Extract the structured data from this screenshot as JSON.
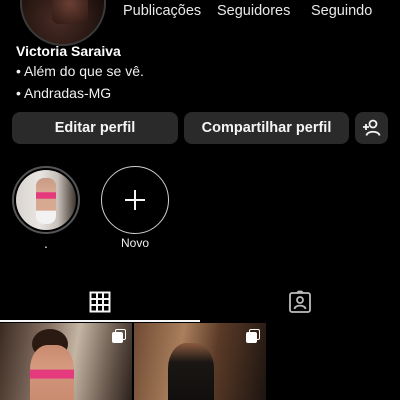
{
  "profile": {
    "stats": {
      "posts_label": "Publicações",
      "followers_label": "Seguidores",
      "following_label": "Seguindo"
    },
    "name": "Victoria Saraiva",
    "bio_lines": [
      "• Além do que se vê.",
      "• Andradas-MG"
    ]
  },
  "actions": {
    "edit_label": "Editar perfil",
    "share_label": "Compartilhar perfil",
    "add_person_icon": "add-person-icon"
  },
  "highlights": [
    {
      "label": "."
    },
    {
      "label": "Novo",
      "icon": "plus-icon"
    }
  ],
  "tabs": [
    {
      "name": "posts-grid",
      "icon": "grid-icon",
      "selected": true
    },
    {
      "name": "tagged",
      "icon": "tagged-person-icon",
      "selected": false
    }
  ],
  "posts": [
    {
      "type": "carousel",
      "icon": "multiple-photos-icon"
    },
    {
      "type": "carousel",
      "icon": "multiple-photos-icon"
    }
  ],
  "colors": {
    "background": "#000000",
    "button": "#2a2a2a",
    "text": "#f5f5f5"
  }
}
